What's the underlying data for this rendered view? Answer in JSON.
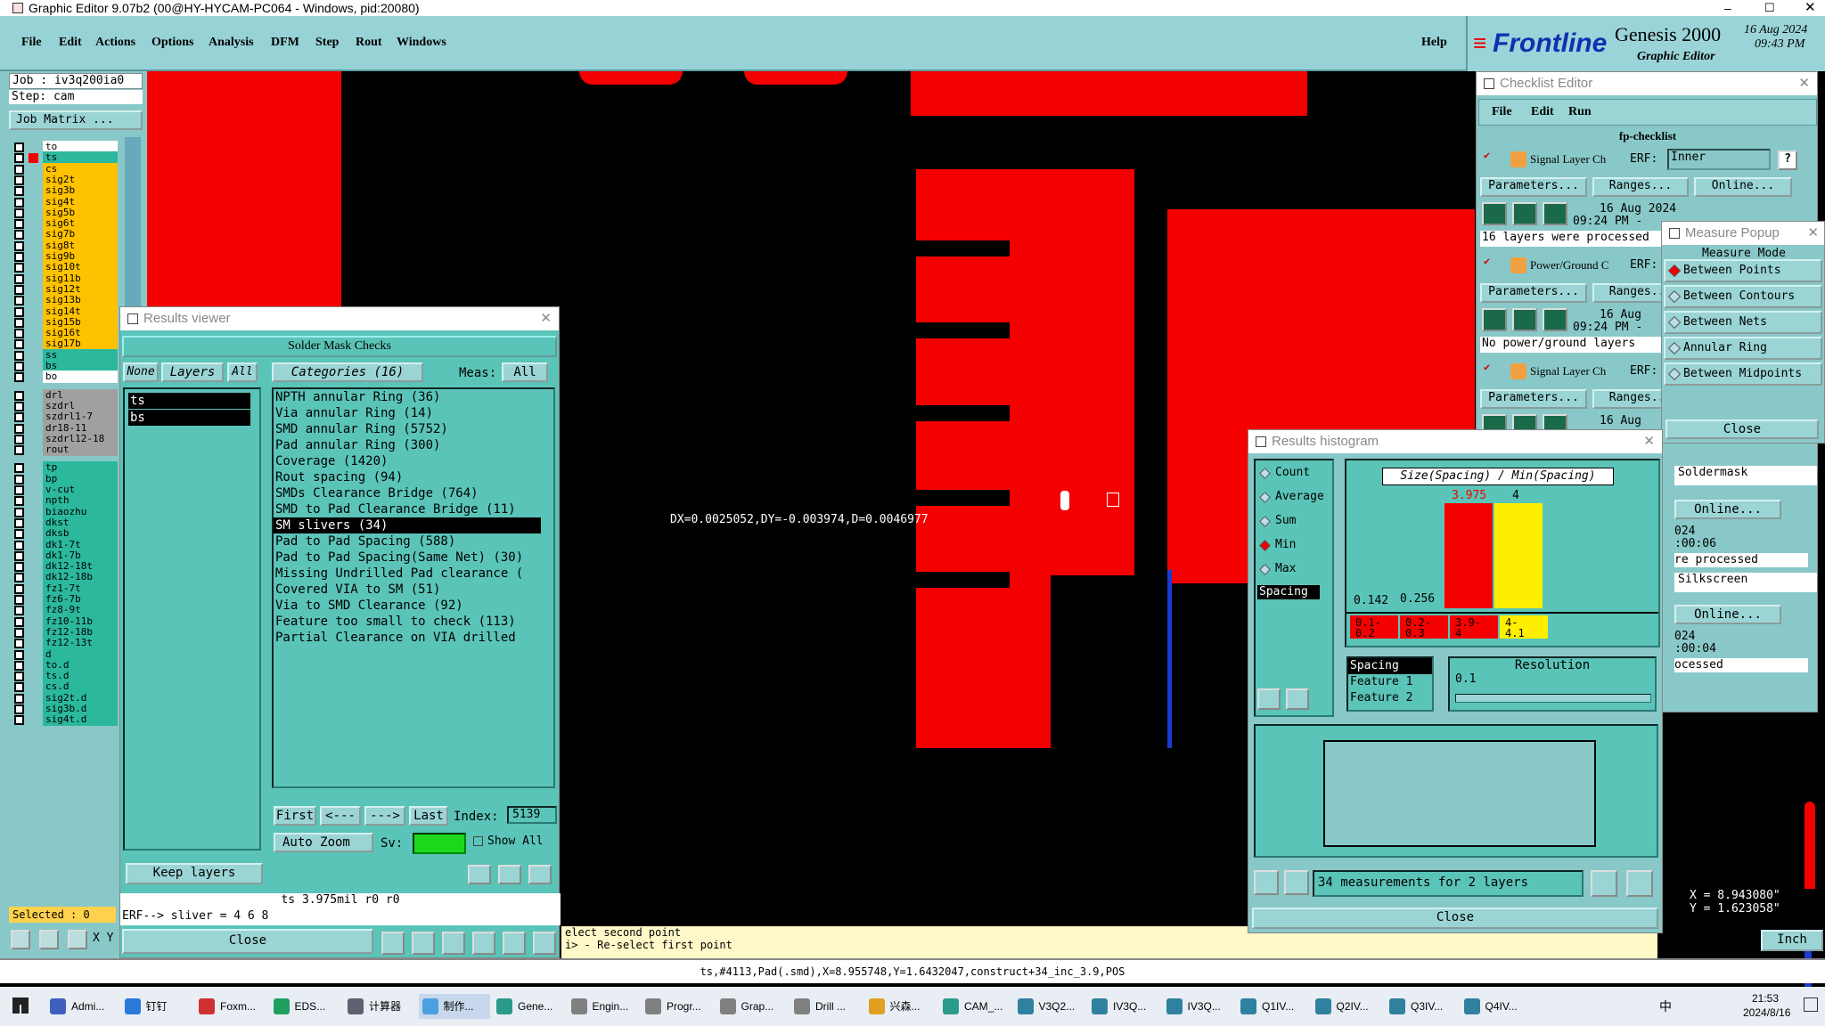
{
  "window": {
    "title": "Graphic Editor 9.07b2 (00@HY-HYCAM-PC064 - Windows, pid:20080)"
  },
  "menu": [
    "File",
    "Edit",
    "Actions",
    "Options",
    "Analysis",
    "DFM",
    "Step",
    "Rout",
    "Windows"
  ],
  "help": "Help",
  "logo": {
    "brand": "Frontline",
    "product": "Genesis 2000",
    "subtitle": "Graphic Editor",
    "date": "16 Aug 2024",
    "time": "09:43 PM"
  },
  "job": {
    "job": "Job : iv3q200ia0",
    "step": "Step: cam",
    "matrix": "Job Matrix ...",
    "selected": "Selected : 0"
  },
  "layers": [
    {
      "n": "to",
      "c": "#ffffff"
    },
    {
      "n": "ts",
      "c": "#2bb89c"
    },
    {
      "n": "cs",
      "c": "#ffc200"
    },
    {
      "n": "sig2t",
      "c": "#ffc200"
    },
    {
      "n": "sig3b",
      "c": "#ffc200"
    },
    {
      "n": "sig4t",
      "c": "#ffc200"
    },
    {
      "n": "sig5b",
      "c": "#ffc200"
    },
    {
      "n": "sig6t",
      "c": "#ffc200"
    },
    {
      "n": "sig7b",
      "c": "#ffc200"
    },
    {
      "n": "sig8t",
      "c": "#ffc200"
    },
    {
      "n": "sig9b",
      "c": "#ffc200"
    },
    {
      "n": "sig10t",
      "c": "#ffc200"
    },
    {
      "n": "sig11b",
      "c": "#ffc200"
    },
    {
      "n": "sig12t",
      "c": "#ffc200"
    },
    {
      "n": "sig13b",
      "c": "#ffc200"
    },
    {
      "n": "sig14t",
      "c": "#ffc200"
    },
    {
      "n": "sig15b",
      "c": "#ffc200"
    },
    {
      "n": "sig16t",
      "c": "#ffc200"
    },
    {
      "n": "sig17b",
      "c": "#ffc200"
    },
    {
      "n": "ss",
      "c": "#2bb89c"
    },
    {
      "n": "bs",
      "c": "#2bb89c"
    },
    {
      "n": "bo",
      "c": "#ffffff"
    },
    {
      "n": "drl",
      "c": "#a0a0a0"
    },
    {
      "n": "szdrl",
      "c": "#a0a0a0"
    },
    {
      "n": "szdrl1-7",
      "c": "#a0a0a0"
    },
    {
      "n": "dr18-11",
      "c": "#a0a0a0"
    },
    {
      "n": "szdrl12-18",
      "c": "#a0a0a0"
    },
    {
      "n": "rout",
      "c": "#a0a0a0"
    },
    {
      "n": "tp",
      "c": "#2bb89c"
    },
    {
      "n": "bp",
      "c": "#2bb89c"
    },
    {
      "n": "v-cut",
      "c": "#2bb89c"
    },
    {
      "n": "npth",
      "c": "#2bb89c"
    },
    {
      "n": "biaozhu",
      "c": "#2bb89c"
    },
    {
      "n": "dkst",
      "c": "#2bb89c"
    },
    {
      "n": "dksb",
      "c": "#2bb89c"
    },
    {
      "n": "dk1-7t",
      "c": "#2bb89c"
    },
    {
      "n": "dk1-7b",
      "c": "#2bb89c"
    },
    {
      "n": "dk12-18t",
      "c": "#2bb89c"
    },
    {
      "n": "dk12-18b",
      "c": "#2bb89c"
    },
    {
      "n": "fz1-7t",
      "c": "#2bb89c"
    },
    {
      "n": "fz6-7b",
      "c": "#2bb89c"
    },
    {
      "n": "fz8-9t",
      "c": "#2bb89c"
    },
    {
      "n": "fz10-11b",
      "c": "#2bb89c"
    },
    {
      "n": "fz12-18b",
      "c": "#2bb89c"
    },
    {
      "n": "fz12-13t",
      "c": "#2bb89c"
    },
    {
      "n": "d",
      "c": "#2bb89c"
    },
    {
      "n": "to.d",
      "c": "#2bb89c"
    },
    {
      "n": "ts.d",
      "c": "#2bb89c"
    },
    {
      "n": "cs.d",
      "c": "#2bb89c"
    },
    {
      "n": "sig2t.d",
      "c": "#2bb89c"
    },
    {
      "n": "sig3b.d",
      "c": "#2bb89c"
    },
    {
      "n": "sig4t.d",
      "c": "#2bb89c"
    }
  ],
  "measure_text": "DX=0.0025052,DY=-0.003974,D=0.0046977",
  "results_viewer": {
    "title": "Results viewer",
    "header": "Solder Mask Checks",
    "none": "None",
    "layers": "Layers",
    "all": "All",
    "categories": "Categories (16)",
    "meas": "Meas:",
    "meas_val": "All",
    "layer_list": [
      "ts",
      "bs"
    ],
    "items": [
      "NPTH annular Ring (36)",
      "Via annular Ring (14)",
      "SMD annular Ring (5752)",
      "Pad annular Ring (300)",
      "Coverage (1420)",
      "Rout spacing (94)",
      "SMDs Clearance Bridge (764)",
      "SMD to Pad Clearance Bridge (11)",
      "SM slivers (34)",
      "Pad to Pad Spacing (588)",
      "Pad to Pad Spacing(Same Net) (30)",
      "Missing Undrilled Pad clearance (",
      "Covered VIA to SM (51)",
      "Via to SMD Clearance (92)",
      "Feature too small to check (113)",
      "Partial Clearance on VIA drilled"
    ],
    "first": "First",
    "prev": "<---",
    "next": "--->",
    "last": "Last",
    "index": "Index:",
    "index_val": "5139",
    "autozoom": "Auto Zoom",
    "sv": "Sv:",
    "showall": "Show All",
    "keep": "Keep layers",
    "info": "ts 3.975mil  r0  r0",
    "erf": "ERF--> sliver = 4 6 8",
    "close": "Close"
  },
  "checklist": {
    "title": "Checklist Editor",
    "menu": [
      "File",
      "Edit",
      "Run"
    ],
    "name": "fp-checklist",
    "rows": [
      {
        "label": "Signal Layer Ch",
        "erf": "ERF:",
        "erfval": "Inner",
        "params": "Parameters...",
        "ranges": "Ranges...",
        "online": "Online...",
        "date": "16 Aug 2024",
        "time": "09:24 PM -",
        "msg": "16 layers were processed"
      },
      {
        "label": "Power/Ground C",
        "erf": "ERF:",
        "erfval": "",
        "params": "Parameters...",
        "ranges": "Ranges...",
        "online": "Online...",
        "date": "16 Aug",
        "time": "09:24 PM -",
        "msg": "No power/ground layers"
      },
      {
        "label": "Signal Layer Ch",
        "erf": "ERF:",
        "erfval": "",
        "params": "Parameters...",
        "ranges": "Ranges...",
        "online": "",
        "date": "16 Aug",
        "time": "",
        "msg": ""
      }
    ],
    "right": {
      "soldermask": "Soldermask",
      "silkscreen": "Silkscreen",
      "online": "Online...",
      "d1": "024",
      "t1": ":00:06",
      "m1": "re processed",
      "d2": "024",
      "t2": ":00:04",
      "m2": "ocessed"
    }
  },
  "measure": {
    "title": "Measure Popup",
    "mode": "Measure Mode",
    "options": [
      "Between Points",
      "Between Contours",
      "Between Nets",
      "Annular Ring",
      "Between Midpoints"
    ],
    "close": "Close"
  },
  "histogram": {
    "title": "Results histogram",
    "radios": [
      "Count",
      "Average",
      "Sum",
      "Min",
      "Max"
    ],
    "selected": "Min",
    "spacing": "Spacing",
    "graph_title": "Size(Spacing) / Min(Spacing)",
    "bar_labels": [
      "0.142",
      "0.256",
      "3.975",
      "4"
    ],
    "bins": [
      "0.1-\n0.2",
      "0.2-\n0.3",
      "3.9-\n4",
      "4-\n4.1"
    ],
    "list": [
      "Spacing",
      "Feature 1",
      "Feature 2"
    ],
    "resolution": "Resolution",
    "res_val": "0.1",
    "count": "34 measurements for 2 layers",
    "close": "Close"
  },
  "coords": {
    "x": "X = 8.943080\"",
    "y": "Y = 1.623058\""
  },
  "prompt": {
    "line1": "elect second point",
    "line2": "i> - Re-select first point"
  },
  "units": "Inch",
  "statusbar": "ts,#4113,Pad(.smd),X=8.955748,Y=1.6432047,construct+34_inc_3.9,POS",
  "taskbar": {
    "items": [
      "Admi...",
      "钉钉",
      "Foxm...",
      "EDS...",
      "计算器",
      "制作...",
      "Gene...",
      "Engin...",
      "Progr...",
      "Grap...",
      "Drill ...",
      "兴森...",
      "CAM_...",
      "V3Q2...",
      "IV3Q...",
      "IV3Q...",
      "Q1IV...",
      "Q2IV...",
      "Q3IV...",
      "Q4IV..."
    ],
    "time": "21:53",
    "date": "2024/8/16",
    "lang": "中"
  }
}
